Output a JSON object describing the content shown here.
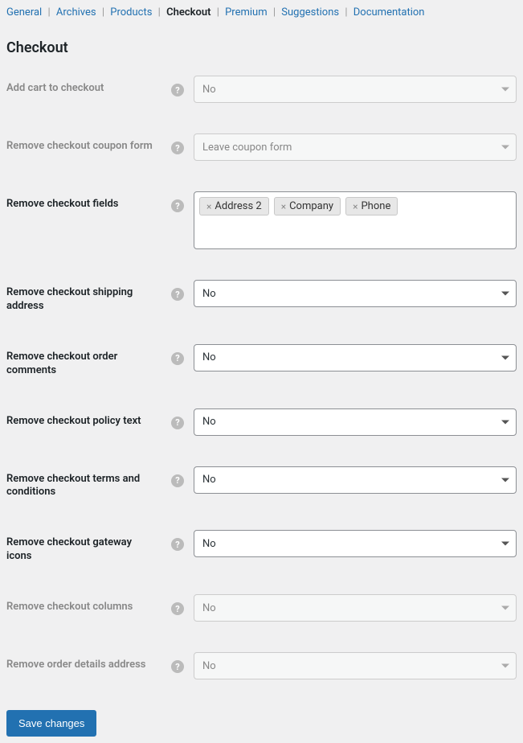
{
  "tabs": {
    "general": "General",
    "archives": "Archives",
    "products": "Products",
    "checkout": "Checkout",
    "premium": "Premium",
    "suggestions": "Suggestions",
    "documentation": "Documentation"
  },
  "page_title": "Checkout",
  "fields": {
    "add_cart": {
      "label": "Add cart to checkout",
      "value": "No"
    },
    "remove_coupon": {
      "label": "Remove checkout coupon form",
      "value": "Leave coupon form"
    },
    "remove_fields": {
      "label": "Remove checkout fields",
      "tags": [
        "Address 2",
        "Company",
        "Phone"
      ]
    },
    "remove_shipping": {
      "label": "Remove checkout shipping address",
      "value": "No"
    },
    "remove_comments": {
      "label": "Remove checkout order comments",
      "value": "No"
    },
    "remove_policy": {
      "label": "Remove checkout policy text",
      "value": "No"
    },
    "remove_terms": {
      "label": "Remove checkout terms and conditions",
      "value": "No"
    },
    "remove_gateway": {
      "label": "Remove checkout gateway icons",
      "value": "No"
    },
    "remove_columns": {
      "label": "Remove checkout columns",
      "value": "No"
    },
    "remove_order_address": {
      "label": "Remove order details address",
      "value": "No"
    }
  },
  "submit_label": "Save changes"
}
